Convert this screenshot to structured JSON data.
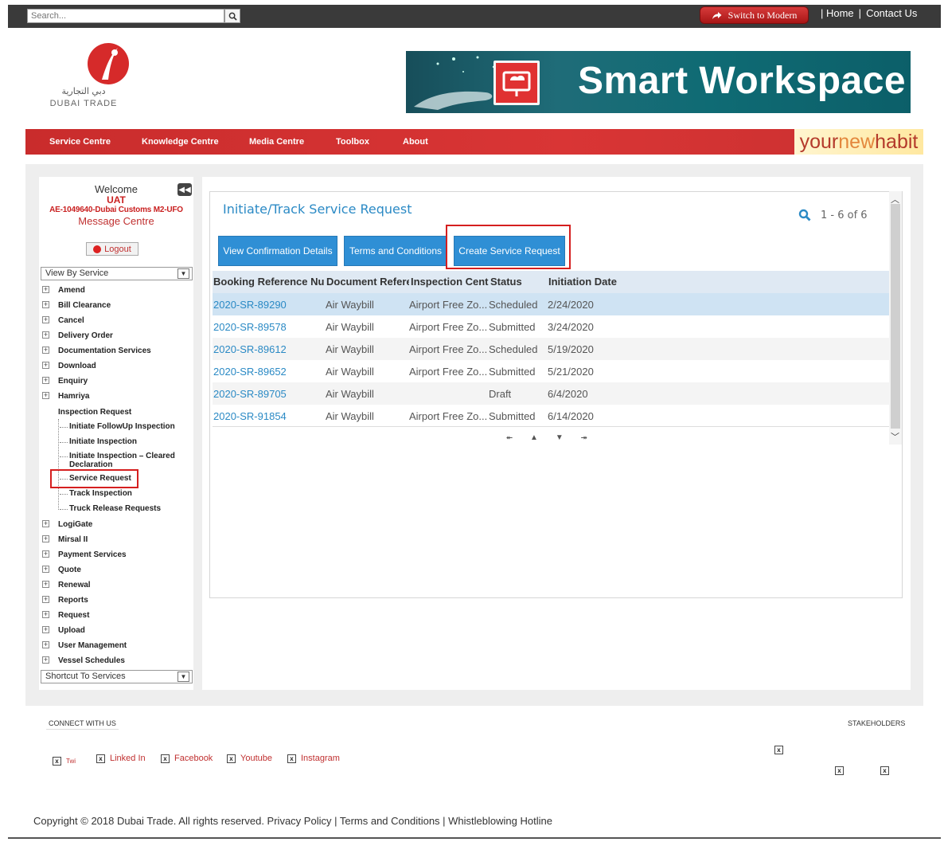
{
  "topbar": {
    "search_placeholder": "Search...",
    "switch_label": "Switch to Modern",
    "links": [
      "| Home",
      "|",
      "Contact Us"
    ]
  },
  "header": {
    "logo_ar": "دبي التجارية",
    "logo_en": "DUBAI TRADE",
    "banner_title": "Smart Workspace"
  },
  "nav": {
    "items": [
      "Service Centre",
      "Knowledge Centre",
      "Media Centre",
      "Toolbox",
      "About"
    ],
    "tagline_your": "your",
    "tagline_new": "new",
    "tagline_habit": "habit"
  },
  "sidebar": {
    "welcome": "Welcome",
    "env": "UAT",
    "account": "AE-1049640-Dubai Customs M2-UFO",
    "message_centre": "Message Centre",
    "logout": "Logout",
    "view_by": "View By Service",
    "tree": [
      "Amend",
      "Bill Clearance",
      "Cancel",
      "Delivery Order",
      "Documentation Services",
      "Download",
      "Enquiry",
      "Hamriya"
    ],
    "inspection_group": "Inspection Request",
    "inspection_children": [
      "Initiate FollowUp Inspection",
      "Initiate Inspection",
      "Initiate Inspection – Cleared Declaration",
      "Service Request",
      "Track Inspection",
      "Truck Release Requests"
    ],
    "tree_after": [
      "LogiGate",
      "Mirsal II",
      "Payment Services",
      "Quote",
      "Renewal",
      "Reports",
      "Request",
      "Upload",
      "User Management",
      "Vessel Schedules"
    ],
    "shortcut": "Shortcut To Services"
  },
  "main": {
    "title": "Initiate/Track Service Request",
    "pager": "1 - 6 of 6",
    "buttons": [
      "View Confirmation Details",
      "Terms and Conditions",
      "Create Service Request"
    ],
    "columns": [
      "Booking Reference Nun",
      "Document Refere",
      "Inspection Centr",
      "Status",
      "Initiation Date"
    ],
    "rows": [
      {
        "ref": "2020-SR-89290",
        "doc": "Air Waybill",
        "centre": "Airport Free Zo...",
        "status": "Scheduled",
        "date": "2/24/2020"
      },
      {
        "ref": "2020-SR-89578",
        "doc": "Air Waybill",
        "centre": "Airport Free Zo...",
        "status": "Submitted",
        "date": "3/24/2020"
      },
      {
        "ref": "2020-SR-89612",
        "doc": "Air Waybill",
        "centre": "Airport Free Zo...",
        "status": "Scheduled",
        "date": "5/19/2020"
      },
      {
        "ref": "2020-SR-89652",
        "doc": "Air Waybill",
        "centre": "Airport Free Zo...",
        "status": "Submitted",
        "date": "5/21/2020"
      },
      {
        "ref": "2020-SR-89705",
        "doc": "Air Waybill",
        "centre": "",
        "status": "Draft",
        "date": "6/4/2020"
      },
      {
        "ref": "2020-SR-91854",
        "doc": "Air Waybill",
        "centre": "Airport Free Zo...",
        "status": "Submitted",
        "date": "6/14/2020"
      }
    ]
  },
  "footer": {
    "connect": "CONNECT WITH US",
    "stakeholders": "STAKEHOLDERS",
    "social": [
      "Twi",
      "Linked In",
      "Facebook",
      "Youtube",
      "Instagram"
    ],
    "copyright": "Copyright © 2018 Dubai Trade. All rights reserved. Privacy Policy | Terms and Conditions | Whistleblowing Hotline"
  },
  "colors": {
    "accent": "#2f8fd5",
    "brand_red": "#d93535",
    "highlight": "#d51f1f"
  }
}
